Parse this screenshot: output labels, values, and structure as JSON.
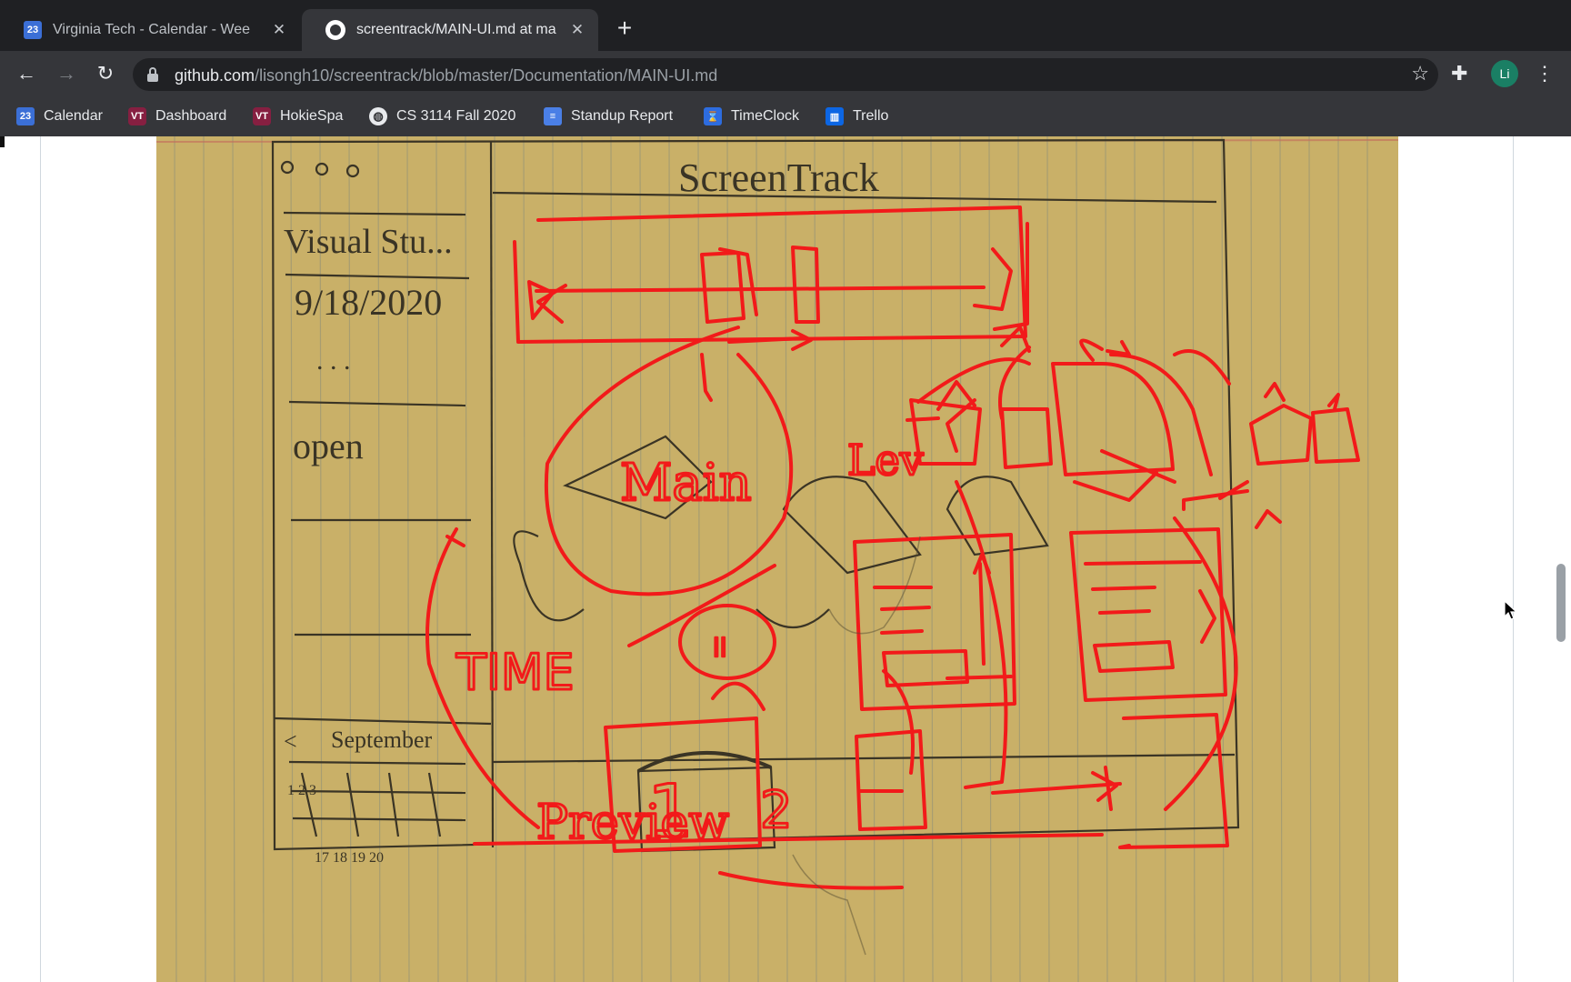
{
  "browser": {
    "tabs": [
      {
        "title": "Virginia Tech - Calendar - Wee",
        "icon": "calendar-favicon-icon",
        "favicon_text": "23",
        "active": false
      },
      {
        "title": "screentrack/MAIN-UI.md at ma",
        "icon": "github-favicon-icon",
        "active": true
      }
    ],
    "url_host": "github.com",
    "url_path": "/lisongh10/screentrack/blob/master/Documentation/MAIN-UI.md",
    "profile_initials": "Li",
    "bookmarks": [
      {
        "label": "Calendar",
        "icon": "calendar-icon",
        "icon_text": "23"
      },
      {
        "label": "Dashboard",
        "icon": "vt-logo-icon",
        "icon_text": "VT"
      },
      {
        "label": "HokieSpa",
        "icon": "vt-logo-icon",
        "icon_text": "VT"
      },
      {
        "label": "CS 3114 Fall 2020",
        "icon": "globe-icon"
      },
      {
        "label": "Standup Report",
        "icon": "document-icon"
      },
      {
        "label": "TimeClock",
        "icon": "hourglass-icon"
      },
      {
        "label": "Trello",
        "icon": "trello-icon"
      }
    ]
  },
  "sketch": {
    "title": "ScreenTrack",
    "app_label": "Visual Stu...",
    "date": "9/18/2020",
    "ellipsis": ". . .",
    "open_label": "open",
    "month": "September",
    "month_prev": "<",
    "days_row1": "1  2  3",
    "days_row2": "17 18 19 20",
    "time_label": "TIME",
    "pause_label": "ll",
    "main_label": "Main",
    "level_label": "Lev",
    "preview_label": "Preview",
    "number_1": "1",
    "number_2": "2"
  },
  "colors": {
    "pen_red": "#f21a1a",
    "pencil": "#3a3425",
    "paper": "#c9b068",
    "tab_bar": "#1f2023",
    "toolbar": "#35363a"
  }
}
